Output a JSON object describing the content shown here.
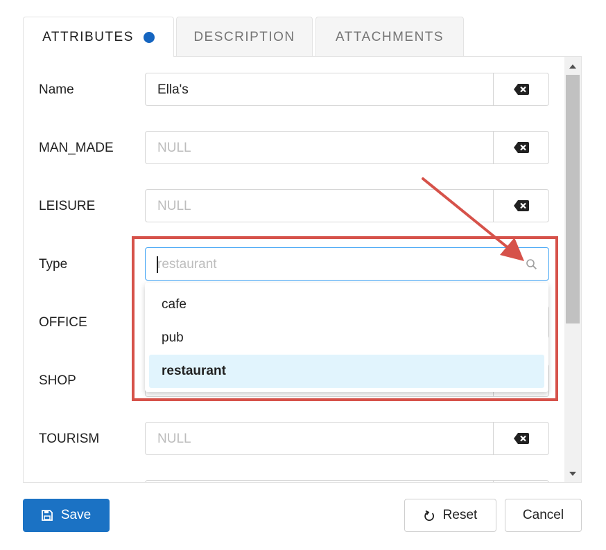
{
  "tabs": [
    {
      "label": "ATTRIBUTES",
      "active": true,
      "modified_dot": true
    },
    {
      "label": "DESCRIPTION",
      "active": false
    },
    {
      "label": "ATTACHMENTS",
      "active": false
    }
  ],
  "fields": [
    {
      "label": "Name",
      "value": "Ella's",
      "placeholder": ""
    },
    {
      "label": "MAN_MADE",
      "value": "",
      "placeholder": "NULL"
    },
    {
      "label": "LEISURE",
      "value": "",
      "placeholder": "NULL"
    },
    {
      "label": "Type",
      "value": "",
      "placeholder": "restaurant"
    },
    {
      "label": "OFFICE",
      "value": "",
      "placeholder": ""
    },
    {
      "label": "SHOP",
      "value": "",
      "placeholder": ""
    },
    {
      "label": "TOURISM",
      "value": "",
      "placeholder": "NULL"
    }
  ],
  "type_dropdown": {
    "options": [
      "cafe",
      "pub",
      "restaurant"
    ],
    "selected": "restaurant"
  },
  "footer": {
    "save_label": "Save",
    "reset_label": "Reset",
    "cancel_label": "Cancel"
  },
  "colors": {
    "primary": "#1b72c4",
    "annotation": "#d6524a",
    "selected_option_bg": "#e1f4fd",
    "modified_dot": "#1565c0"
  },
  "icons": {
    "clear": "backspace-icon",
    "search": "search-icon",
    "save": "floppy-disk-icon",
    "reset": "reset-icon",
    "scroll_up": "triangle-up-icon",
    "scroll_down": "triangle-down-icon"
  }
}
